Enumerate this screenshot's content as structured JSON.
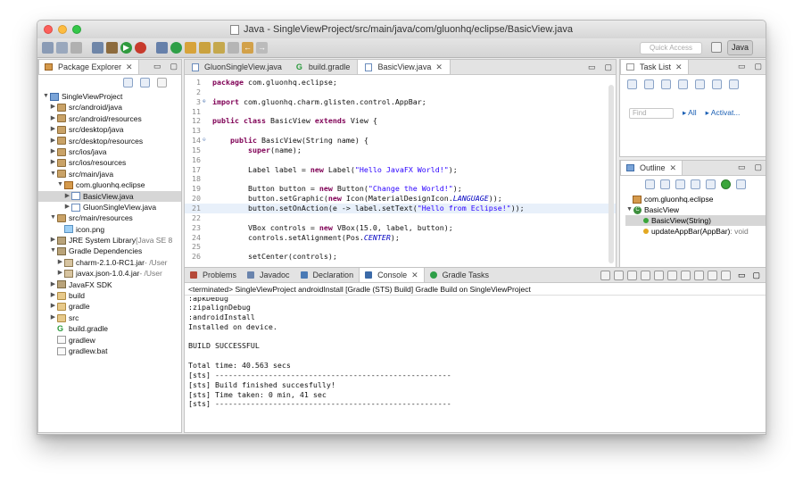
{
  "window": {
    "title": "Java - SingleViewProject/src/main/java/com/gluonhq/eclipse/BasicView.java"
  },
  "toolbar": {
    "quick_access_placeholder": "Quick Access",
    "perspective_label": "Java"
  },
  "package_explorer": {
    "tab_label": "Package Explorer",
    "items": [
      {
        "label": "SingleViewProject",
        "depth": 0,
        "icon": "project-icon"
      },
      {
        "label": "src/android/java",
        "depth": 1,
        "icon": "source-folder-icon"
      },
      {
        "label": "src/android/resources",
        "depth": 1,
        "icon": "source-folder-icon"
      },
      {
        "label": "src/desktop/java",
        "depth": 1,
        "icon": "source-folder-icon"
      },
      {
        "label": "src/desktop/resources",
        "depth": 1,
        "icon": "source-folder-icon"
      },
      {
        "label": "src/ios/java",
        "depth": 1,
        "icon": "source-folder-icon"
      },
      {
        "label": "src/ios/resources",
        "depth": 1,
        "icon": "source-folder-icon"
      },
      {
        "label": "src/main/java",
        "depth": 1,
        "icon": "source-folder-icon"
      },
      {
        "label": "com.gluonhq.eclipse",
        "depth": 2,
        "icon": "package-icon"
      },
      {
        "label": "BasicView.java",
        "depth": 3,
        "icon": "java-file-icon"
      },
      {
        "label": "GluonSingleView.java",
        "depth": 3,
        "icon": "java-file-icon"
      },
      {
        "label": "src/main/resources",
        "depth": 1,
        "icon": "source-folder-icon"
      },
      {
        "label": "icon.png",
        "depth": 2,
        "icon": "image-file-icon"
      },
      {
        "label": "JRE System Library",
        "suffix": "[Java SE 8",
        "depth": 1,
        "icon": "library-icon"
      },
      {
        "label": "Gradle Dependencies",
        "depth": 1,
        "icon": "library-icon"
      },
      {
        "label": "charm-2.1.0-RC1.jar",
        "suffix": "- /User",
        "depth": 2,
        "icon": "jar-icon"
      },
      {
        "label": "javax.json-1.0.4.jar",
        "suffix": "- /User",
        "depth": 2,
        "icon": "jar-icon"
      },
      {
        "label": "JavaFX SDK",
        "depth": 1,
        "icon": "library-icon"
      },
      {
        "label": "build",
        "depth": 1,
        "icon": "folder-icon"
      },
      {
        "label": "gradle",
        "depth": 1,
        "icon": "folder-icon"
      },
      {
        "label": "src",
        "depth": 1,
        "icon": "folder-icon"
      },
      {
        "label": "build.gradle",
        "depth": 1,
        "icon": "gradle-file-icon"
      },
      {
        "label": "gradlew",
        "depth": 1,
        "icon": "file-icon"
      },
      {
        "label": "gradlew.bat",
        "depth": 1,
        "icon": "file-icon"
      }
    ]
  },
  "editor": {
    "tabs": [
      {
        "label": "GluonSingleView.java"
      },
      {
        "label": "build.gradle"
      },
      {
        "label": "BasicView.java",
        "active": true
      }
    ],
    "lines": [
      {
        "num": "1",
        "text": "package com.gluonhq.eclipse;"
      },
      {
        "num": "2",
        "text": ""
      },
      {
        "num": "3",
        "text": "import com.gluonhq.charm.glisten.control.AppBar;"
      },
      {
        "num": "11",
        "text": ""
      },
      {
        "num": "12",
        "text": "public class BasicView extends View {"
      },
      {
        "num": "13",
        "text": ""
      },
      {
        "num": "14",
        "text": "    public BasicView(String name) {"
      },
      {
        "num": "15",
        "text": "        super(name);"
      },
      {
        "num": "16",
        "text": ""
      },
      {
        "num": "17",
        "text": "        Label label = new Label(\"Hello JavaFX World!\");"
      },
      {
        "num": "18",
        "text": ""
      },
      {
        "num": "19",
        "text": "        Button button = new Button(\"Change the World!\");"
      },
      {
        "num": "20",
        "text": "        button.setGraphic(new Icon(MaterialDesignIcon.LANGUAGE));"
      },
      {
        "num": "21",
        "text": "        button.setOnAction(e -> label.setText(\"Hello from Eclipse!\"));"
      },
      {
        "num": "22",
        "text": ""
      },
      {
        "num": "23",
        "text": "        VBox controls = new VBox(15.0, label, button);"
      },
      {
        "num": "24",
        "text": "        controls.setAlignment(Pos.CENTER);"
      },
      {
        "num": "25",
        "text": ""
      },
      {
        "num": "26",
        "text": "        setCenter(controls);"
      }
    ]
  },
  "task_list": {
    "tab_label": "Task List",
    "find_placeholder": "Find",
    "all_label": "All",
    "activate_label": "Activat..."
  },
  "outline": {
    "tab_label": "Outline",
    "items": [
      {
        "label": "com.gluonhq.eclipse",
        "icon": "package-icon"
      },
      {
        "label": "BasicView",
        "icon": "class-icon"
      },
      {
        "label": "BasicView(String)",
        "icon": "constructor-icon"
      },
      {
        "label": "updateAppBar(AppBar)",
        "suffix": ": void",
        "icon": "method-icon"
      }
    ]
  },
  "bottom_panel": {
    "tabs": [
      {
        "label": "Problems"
      },
      {
        "label": "Javadoc"
      },
      {
        "label": "Declaration"
      },
      {
        "label": "Console",
        "active": true
      },
      {
        "label": "Gradle Tasks"
      }
    ],
    "console_title": "<terminated> SingleViewProject androidInstall  [Gradle (STS) Build] Gradle Build on SingleViewProject",
    "output": [
      ":apkDebug",
      ":zipalignDebug",
      ":androidInstall",
      "Installed on device.",
      "",
      "BUILD SUCCESSFUL",
      "",
      "Total time: 40.563 secs",
      "[sts] -----------------------------------------------------",
      "[sts] Build finished succesfully!",
      "[sts] Time taken: 0 min, 41 sec",
      "[sts] -----------------------------------------------------"
    ]
  }
}
